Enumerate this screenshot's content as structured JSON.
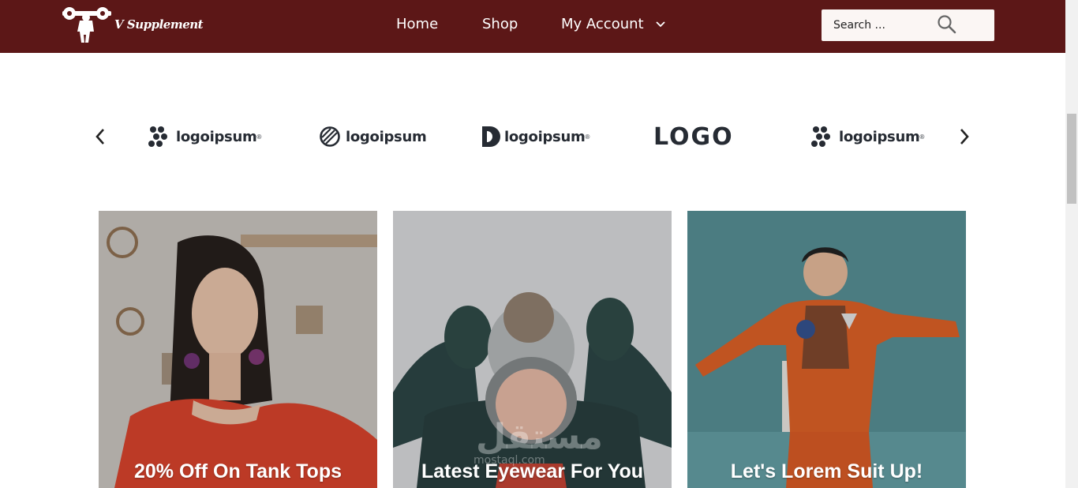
{
  "header": {
    "brand_name": "V Supplement",
    "nav": [
      {
        "label": "Home"
      },
      {
        "label": "Shop"
      },
      {
        "label": "My Account"
      }
    ],
    "search": {
      "placeholder": "Search ..."
    },
    "colors": {
      "bar": "#5c1717",
      "search_bg": "#fbf6f4"
    }
  },
  "logos": {
    "items": [
      {
        "text": "logoipsum",
        "mark": "dots-icon",
        "trademark": "®"
      },
      {
        "text": "logoipsum",
        "mark": "circle-slash-icon",
        "trademark": ""
      },
      {
        "text": "logoipsum",
        "mark": "half-circle-icon",
        "trademark": "®"
      },
      {
        "text": "LOGO",
        "mark": "block-logo",
        "trademark": ""
      },
      {
        "text": "logoipsum",
        "mark": "dots-icon",
        "trademark": "®"
      }
    ]
  },
  "cards": [
    {
      "title": "20% Off On Tank Tops"
    },
    {
      "title": "Latest Eyewear For You"
    },
    {
      "title": "Let's Lorem Suit Up!"
    }
  ],
  "watermark": {
    "text": "مستقل",
    "sub": "mostaql.com"
  }
}
